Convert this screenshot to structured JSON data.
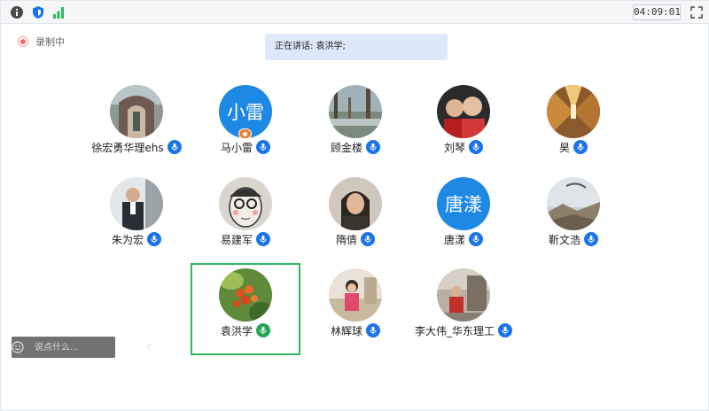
{
  "toolbar": {
    "icons": [
      "info-icon",
      "security-shield-icon",
      "network-signal-icon",
      "fullscreen-icon"
    ],
    "clock": "04:09:01"
  },
  "recording": {
    "label": "录制中",
    "icon": "record-icon"
  },
  "speaking_banner": "正在讲话: 袁洪学;",
  "participants": [
    {
      "name": "徐宏勇华理ehs",
      "avatar_type": "photo",
      "mic": "on"
    },
    {
      "name": "马小雷",
      "avatar_type": "text",
      "avatar_text": "小雷",
      "host": true,
      "mic": "on"
    },
    {
      "name": "顾金楼",
      "avatar_type": "photo",
      "mic": "on"
    },
    {
      "name": "刘琴",
      "avatar_type": "photo",
      "mic": "on"
    },
    {
      "name": "昊",
      "avatar_type": "photo",
      "mic": "on"
    },
    {
      "name": "朱为宏",
      "avatar_type": "photo",
      "mic": "on"
    },
    {
      "name": "易建军",
      "avatar_type": "photo",
      "mic": "on"
    },
    {
      "name": "隋倩",
      "avatar_type": "photo",
      "mic": "on"
    },
    {
      "name": "唐漾",
      "avatar_type": "text",
      "avatar_text": "唐漾",
      "mic": "on"
    },
    {
      "name": "靳文浩",
      "avatar_type": "photo",
      "mic": "on"
    },
    {
      "name": "袁洪学",
      "avatar_type": "photo",
      "mic": "talking",
      "active_speaker": true
    },
    {
      "name": "林辉球",
      "avatar_type": "photo",
      "mic": "on"
    },
    {
      "name": "李大伟_华东理工",
      "avatar_type": "photo",
      "mic": "on"
    }
  ],
  "chat": {
    "placeholder": "说点什么...",
    "toggle_icon": "chevron-left-icon",
    "emoji_icon": "emoji-icon"
  },
  "colors": {
    "mic_on": "#1a73e8",
    "mic_talking": "#23a455",
    "active_border": "#2db85c",
    "text_avatar": "#1e88e5",
    "banner_bg": "#dde9f8"
  }
}
